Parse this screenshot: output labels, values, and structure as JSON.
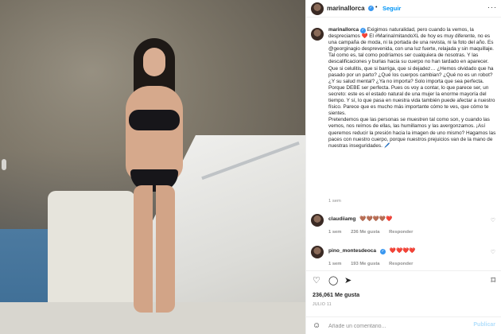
{
  "post": {
    "username": "marinallorca",
    "follow_label": "Seguir",
    "more_label": "···",
    "caption": [
      "Exigimos naturalidad, pero cuando la vemos, la despreciamos ❤️ El #MarinaImitandoXL de hoy es muy diferente, no es una campaña de moda, ni la portada de una revista, ni la foto del año. Es @georginagio desprevenida, con una luz fuerte, relajada y sin maquillaje. Tal como es, tal como podríamos ser cualquiera de nosotras. Y las descalificaciones y burlas hacia su cuerpo no han tardado en aparecer. Que si celulitis, que si barriga, que si dejadez… ¿Hemos olvidado que ha pasado por un parto? ¿Qué los cuerpos cambian? ¿Qué no es un robot? ¿Y su salud mental? ¿Ya no importa? Solo importa que sea perfecta. Porque DEBE ser perfecta. Pues os voy a contar, lo que parece ser, un secreto: este es el estado natural de una mujer la enorme mayoría del tiempo. Y sí, lo que pasa en nuestra vida también puede afectar a nuestro físico. Parece que es mucho más importante cómo te ves, que cómo te sientes.",
      "Pretendemos que las personas se muestren tal como son, y cuando las vemos, nos reímos de ellas, las humillamos y las avergonzamos. ¡Así queremos reducir la presión hacia la imagen de uno mismo? Hagamos las paces con nuestro cuerpo, porque nuestros prejuicios van de la mano de nuestras inseguridades. 🖊️"
    ],
    "caption_time": "1 sem"
  },
  "comments": [
    {
      "username": "claudiiamg",
      "text": "🤎🤎🤎🤎❤️",
      "time": "1 sem",
      "likes": "236 Me gusta",
      "reply": "Responder"
    },
    {
      "username": "pino_montesdeoca",
      "text": "❤️❤️❤️❤️",
      "time": "1 sem",
      "likes": "193 Me gusta",
      "reply": "Responder"
    }
  ],
  "actions": {
    "likes_count": "236,061 Me gusta",
    "date": "JULIO 11"
  },
  "add_comment": {
    "placeholder": "Añade un comentario...",
    "publish_label": "Publicar"
  },
  "colors": {
    "accent": "#0095f6",
    "verified": "#3897f0",
    "muted": "#8e8e8e"
  },
  "icons": [
    "heart-icon",
    "comment-icon",
    "share-icon",
    "bookmark-icon",
    "emoji-icon",
    "verified-icon",
    "more-icon"
  ]
}
